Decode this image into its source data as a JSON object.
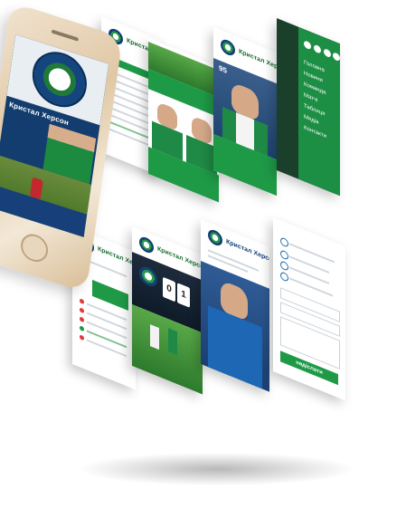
{
  "brand": {
    "team_name": "Кристал Херсон",
    "phone_title": "Кристал Херсон"
  },
  "cards": {
    "table": {
      "title": "Кристал Херсон"
    },
    "players": {
      "title": "Кристал Херсон"
    },
    "profile": {
      "title": "Кристал Херсон",
      "number": "95"
    },
    "menu": {
      "items": [
        "Головна",
        "Новини",
        "Команда",
        "Матчі",
        "Таблиця",
        "Медіа",
        "Контакти"
      ]
    },
    "standings": {
      "title": "Кристал Херсон"
    },
    "match": {
      "title": "Кристал Херсон",
      "score_home": "0",
      "score_away": "1"
    },
    "coach": {
      "title": "Кристал Херсон"
    },
    "contacts": {
      "button_label": "надіслати"
    }
  },
  "colors": {
    "brand_green": "#1e9a47",
    "brand_navy": "#123f75"
  }
}
